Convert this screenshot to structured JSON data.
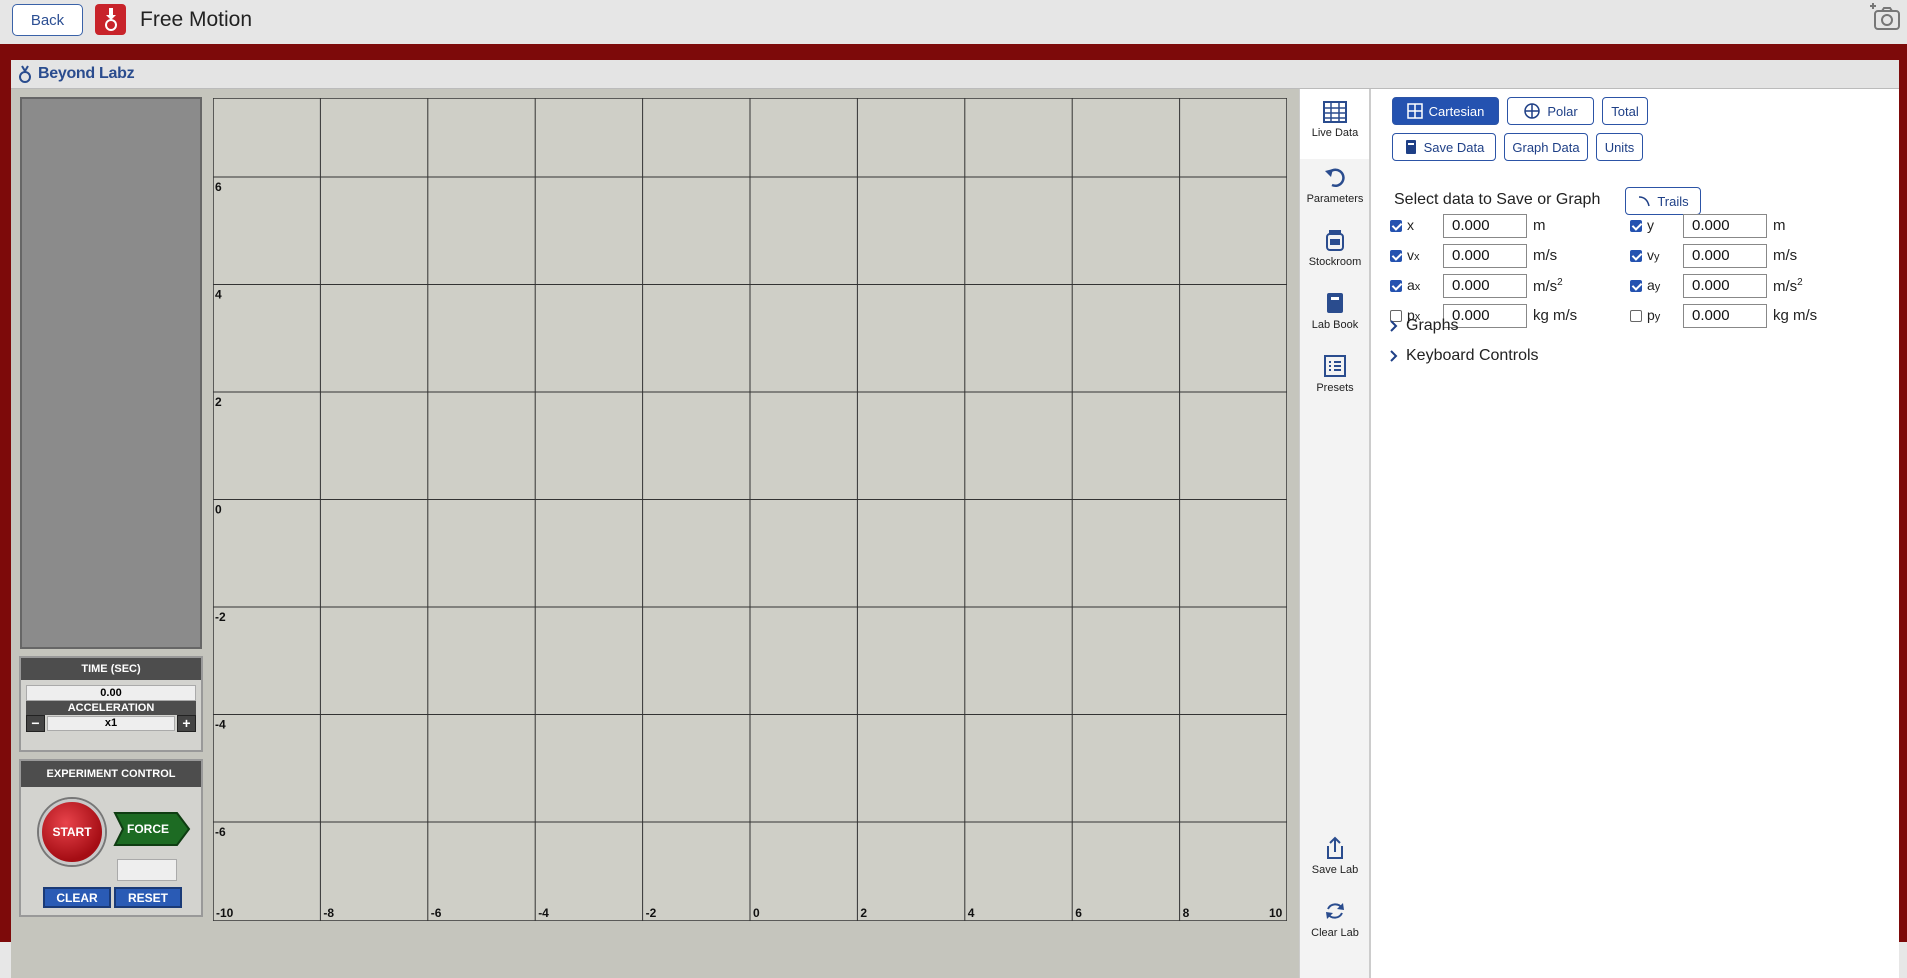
{
  "topbar": {
    "back_label": "Back",
    "title": "Free Motion"
  },
  "brand": {
    "name": "Beyond Labz"
  },
  "time_panel": {
    "heading": "TIME (SEC)",
    "time_value": "0.00",
    "accel_heading": "ACCELERATION",
    "accel_value": "x1",
    "minus": "−",
    "plus": "+"
  },
  "experiment_control": {
    "heading": "EXPERIMENT CONTROL",
    "start_label": "START",
    "force_label": "FORCE",
    "clear_label": "CLEAR",
    "reset_label": "RESET"
  },
  "grid": {
    "x_ticks": [
      "-10",
      "-8",
      "-6",
      "-4",
      "-2",
      "0",
      "2",
      "4",
      "6",
      "8",
      "10"
    ],
    "y_ticks": [
      "6",
      "4",
      "2",
      "0",
      "-2",
      "-4",
      "-6"
    ]
  },
  "sidebar": {
    "items": [
      {
        "label": "Live Data",
        "icon": "table-icon"
      },
      {
        "label": "Parameters",
        "icon": "rotate-icon"
      },
      {
        "label": "Stockroom",
        "icon": "jar-icon"
      },
      {
        "label": "Lab Book",
        "icon": "book-icon"
      },
      {
        "label": "Presets",
        "icon": "list-icon"
      },
      {
        "label": "Save Lab",
        "icon": "upload-icon"
      },
      {
        "label": "Clear Lab",
        "icon": "refresh-icon"
      }
    ]
  },
  "panel": {
    "mode_buttons": {
      "cartesian": "Cartesian",
      "polar": "Polar",
      "total": "Total"
    },
    "action_buttons": {
      "save_data": "Save Data",
      "graph_data": "Graph Data",
      "units": "Units"
    },
    "select_title": "Select data to Save or Graph",
    "trails_label": "Trails",
    "left_rows": [
      {
        "label": "x",
        "sub": "",
        "value": "0.000",
        "unit": "m",
        "checked": true
      },
      {
        "label": "v",
        "sub": "x",
        "value": "0.000",
        "unit": "m/s",
        "checked": true
      },
      {
        "label": "a",
        "sub": "x",
        "value": "0.000",
        "unit": "m/s",
        "sup": "2",
        "checked": true
      },
      {
        "label": "p",
        "sub": "x",
        "value": "0.000",
        "unit": "kg m/s",
        "checked": false
      }
    ],
    "right_rows": [
      {
        "label": "y",
        "sub": "",
        "value": "0.000",
        "unit": "m",
        "checked": true
      },
      {
        "label": "v",
        "sub": "y",
        "value": "0.000",
        "unit": "m/s",
        "checked": true
      },
      {
        "label": "a",
        "sub": "y",
        "value": "0.000",
        "unit": "m/s",
        "sup": "2",
        "checked": true
      },
      {
        "label": "p",
        "sub": "y",
        "value": "0.000",
        "unit": "kg m/s",
        "checked": false
      }
    ],
    "sections": {
      "graphs": "Graphs",
      "keyboard": "Keyboard Controls"
    }
  },
  "colors": {
    "frame": "#7d0a0a",
    "accent": "#2452b0",
    "grid_bg": "#cfcfc7"
  }
}
